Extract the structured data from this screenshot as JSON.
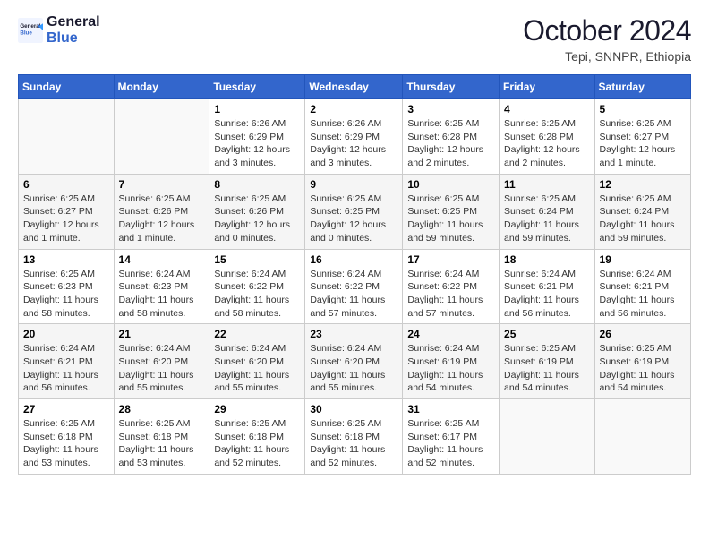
{
  "logo": {
    "line1": "General",
    "line2": "Blue"
  },
  "title": "October 2024",
  "subtitle": "Tepi, SNNPR, Ethiopia",
  "days_header": [
    "Sunday",
    "Monday",
    "Tuesday",
    "Wednesday",
    "Thursday",
    "Friday",
    "Saturday"
  ],
  "weeks": [
    [
      {
        "day": "",
        "detail": ""
      },
      {
        "day": "",
        "detail": ""
      },
      {
        "day": "1",
        "detail": "Sunrise: 6:26 AM\nSunset: 6:29 PM\nDaylight: 12 hours and 3 minutes."
      },
      {
        "day": "2",
        "detail": "Sunrise: 6:26 AM\nSunset: 6:29 PM\nDaylight: 12 hours and 3 minutes."
      },
      {
        "day": "3",
        "detail": "Sunrise: 6:25 AM\nSunset: 6:28 PM\nDaylight: 12 hours and 2 minutes."
      },
      {
        "day": "4",
        "detail": "Sunrise: 6:25 AM\nSunset: 6:28 PM\nDaylight: 12 hours and 2 minutes."
      },
      {
        "day": "5",
        "detail": "Sunrise: 6:25 AM\nSunset: 6:27 PM\nDaylight: 12 hours and 1 minute."
      }
    ],
    [
      {
        "day": "6",
        "detail": "Sunrise: 6:25 AM\nSunset: 6:27 PM\nDaylight: 12 hours and 1 minute."
      },
      {
        "day": "7",
        "detail": "Sunrise: 6:25 AM\nSunset: 6:26 PM\nDaylight: 12 hours and 1 minute."
      },
      {
        "day": "8",
        "detail": "Sunrise: 6:25 AM\nSunset: 6:26 PM\nDaylight: 12 hours and 0 minutes."
      },
      {
        "day": "9",
        "detail": "Sunrise: 6:25 AM\nSunset: 6:25 PM\nDaylight: 12 hours and 0 minutes."
      },
      {
        "day": "10",
        "detail": "Sunrise: 6:25 AM\nSunset: 6:25 PM\nDaylight: 11 hours and 59 minutes."
      },
      {
        "day": "11",
        "detail": "Sunrise: 6:25 AM\nSunset: 6:24 PM\nDaylight: 11 hours and 59 minutes."
      },
      {
        "day": "12",
        "detail": "Sunrise: 6:25 AM\nSunset: 6:24 PM\nDaylight: 11 hours and 59 minutes."
      }
    ],
    [
      {
        "day": "13",
        "detail": "Sunrise: 6:25 AM\nSunset: 6:23 PM\nDaylight: 11 hours and 58 minutes."
      },
      {
        "day": "14",
        "detail": "Sunrise: 6:24 AM\nSunset: 6:23 PM\nDaylight: 11 hours and 58 minutes."
      },
      {
        "day": "15",
        "detail": "Sunrise: 6:24 AM\nSunset: 6:22 PM\nDaylight: 11 hours and 58 minutes."
      },
      {
        "day": "16",
        "detail": "Sunrise: 6:24 AM\nSunset: 6:22 PM\nDaylight: 11 hours and 57 minutes."
      },
      {
        "day": "17",
        "detail": "Sunrise: 6:24 AM\nSunset: 6:22 PM\nDaylight: 11 hours and 57 minutes."
      },
      {
        "day": "18",
        "detail": "Sunrise: 6:24 AM\nSunset: 6:21 PM\nDaylight: 11 hours and 56 minutes."
      },
      {
        "day": "19",
        "detail": "Sunrise: 6:24 AM\nSunset: 6:21 PM\nDaylight: 11 hours and 56 minutes."
      }
    ],
    [
      {
        "day": "20",
        "detail": "Sunrise: 6:24 AM\nSunset: 6:21 PM\nDaylight: 11 hours and 56 minutes."
      },
      {
        "day": "21",
        "detail": "Sunrise: 6:24 AM\nSunset: 6:20 PM\nDaylight: 11 hours and 55 minutes."
      },
      {
        "day": "22",
        "detail": "Sunrise: 6:24 AM\nSunset: 6:20 PM\nDaylight: 11 hours and 55 minutes."
      },
      {
        "day": "23",
        "detail": "Sunrise: 6:24 AM\nSunset: 6:20 PM\nDaylight: 11 hours and 55 minutes."
      },
      {
        "day": "24",
        "detail": "Sunrise: 6:24 AM\nSunset: 6:19 PM\nDaylight: 11 hours and 54 minutes."
      },
      {
        "day": "25",
        "detail": "Sunrise: 6:25 AM\nSunset: 6:19 PM\nDaylight: 11 hours and 54 minutes."
      },
      {
        "day": "26",
        "detail": "Sunrise: 6:25 AM\nSunset: 6:19 PM\nDaylight: 11 hours and 54 minutes."
      }
    ],
    [
      {
        "day": "27",
        "detail": "Sunrise: 6:25 AM\nSunset: 6:18 PM\nDaylight: 11 hours and 53 minutes."
      },
      {
        "day": "28",
        "detail": "Sunrise: 6:25 AM\nSunset: 6:18 PM\nDaylight: 11 hours and 53 minutes."
      },
      {
        "day": "29",
        "detail": "Sunrise: 6:25 AM\nSunset: 6:18 PM\nDaylight: 11 hours and 52 minutes."
      },
      {
        "day": "30",
        "detail": "Sunrise: 6:25 AM\nSunset: 6:18 PM\nDaylight: 11 hours and 52 minutes."
      },
      {
        "day": "31",
        "detail": "Sunrise: 6:25 AM\nSunset: 6:17 PM\nDaylight: 11 hours and 52 minutes."
      },
      {
        "day": "",
        "detail": ""
      },
      {
        "day": "",
        "detail": ""
      }
    ]
  ]
}
